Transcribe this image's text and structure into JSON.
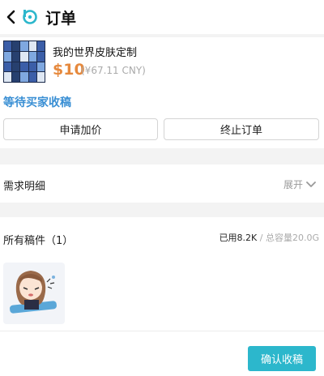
{
  "header": {
    "title": "订单"
  },
  "order": {
    "title": "我的世界皮肤定制",
    "price": "$10",
    "price_cny": "(¥67.11 CNY)",
    "status": "等待买家收稿",
    "raise_price_label": "申请加价",
    "terminate_label": "终止订单"
  },
  "requirements": {
    "title": "需求明细",
    "expand_label": "展开"
  },
  "files": {
    "title": "所有稿件（1）",
    "used": "已用8.2K",
    "total": " / 总容量20.0G"
  },
  "footer": {
    "confirm_label": "确认收稿"
  },
  "colors": {
    "accent": "#2cb7cc",
    "price": "#e6893d",
    "status": "#3a8fd4"
  }
}
